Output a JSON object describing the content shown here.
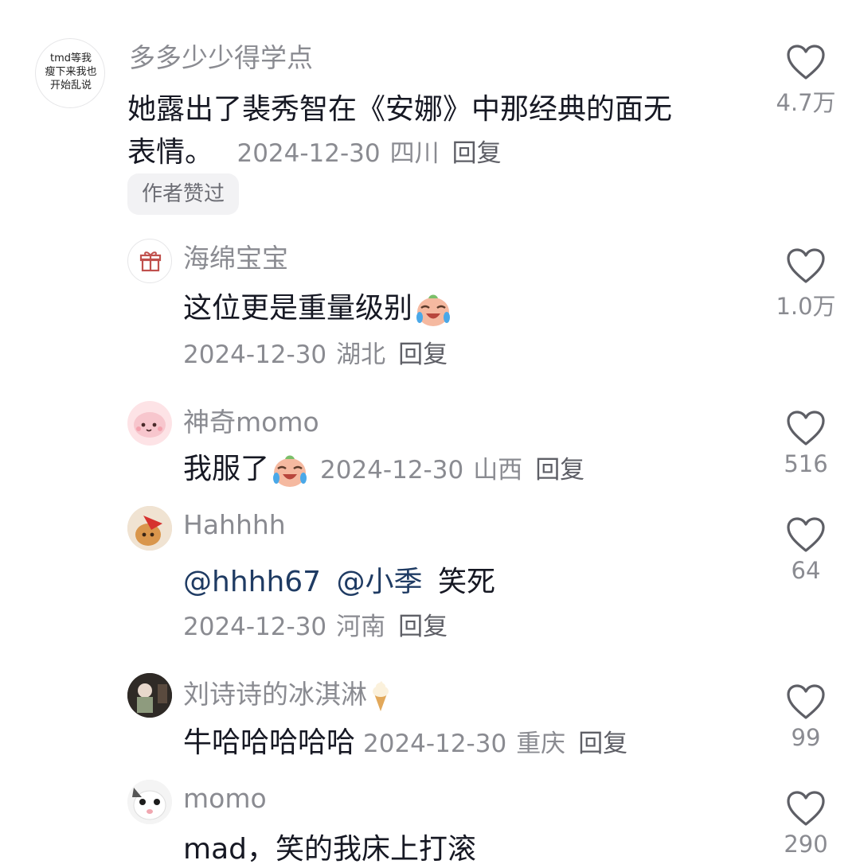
{
  "comments": [
    {
      "avatar_text": [
        "tmd等我",
        "瘦下来我也",
        "开始乱说"
      ],
      "username": "多多少少得学点",
      "text_line1": "她露出了裴秀智在《安娜》中那经典的面无",
      "text_line2": "表情。",
      "date": "2024-12-30",
      "location": "四川",
      "reply": "回复",
      "badge": "作者赞过",
      "likes": "4.7万"
    },
    {
      "username": "海绵宝宝",
      "text": "这位更是重量级别",
      "date": "2024-12-30",
      "location": "湖北",
      "reply": "回复",
      "likes": "1.0万"
    },
    {
      "username": "神奇momo",
      "text": "我服了",
      "date": "2024-12-30",
      "location": "山西",
      "reply": "回复",
      "likes": "516"
    },
    {
      "username": "Hahhhh",
      "mention1": "@hhhh67",
      "mention2": "@小季",
      "text": "笑死",
      "date": "2024-12-30",
      "location": "河南",
      "reply": "回复",
      "likes": "64"
    },
    {
      "username": "刘诗诗的冰淇淋",
      "text": "牛哈哈哈哈哈",
      "date": "2024-12-30",
      "location": "重庆",
      "reply": "回复",
      "likes": "99"
    },
    {
      "username": "momo",
      "text": "mad，笑的我床上打滚",
      "likes": "290"
    }
  ],
  "icons": {
    "like": "heart-outline-icon",
    "emoji_laugh_cry": "laugh-cry-emoji",
    "emoji_ice_cream": "ice-cream-emoji",
    "gift": "gift-icon"
  },
  "colors": {
    "text": "#161823",
    "muted": "#8a8b91",
    "mention": "#1f3b63",
    "badge_bg": "#f2f2f4"
  }
}
